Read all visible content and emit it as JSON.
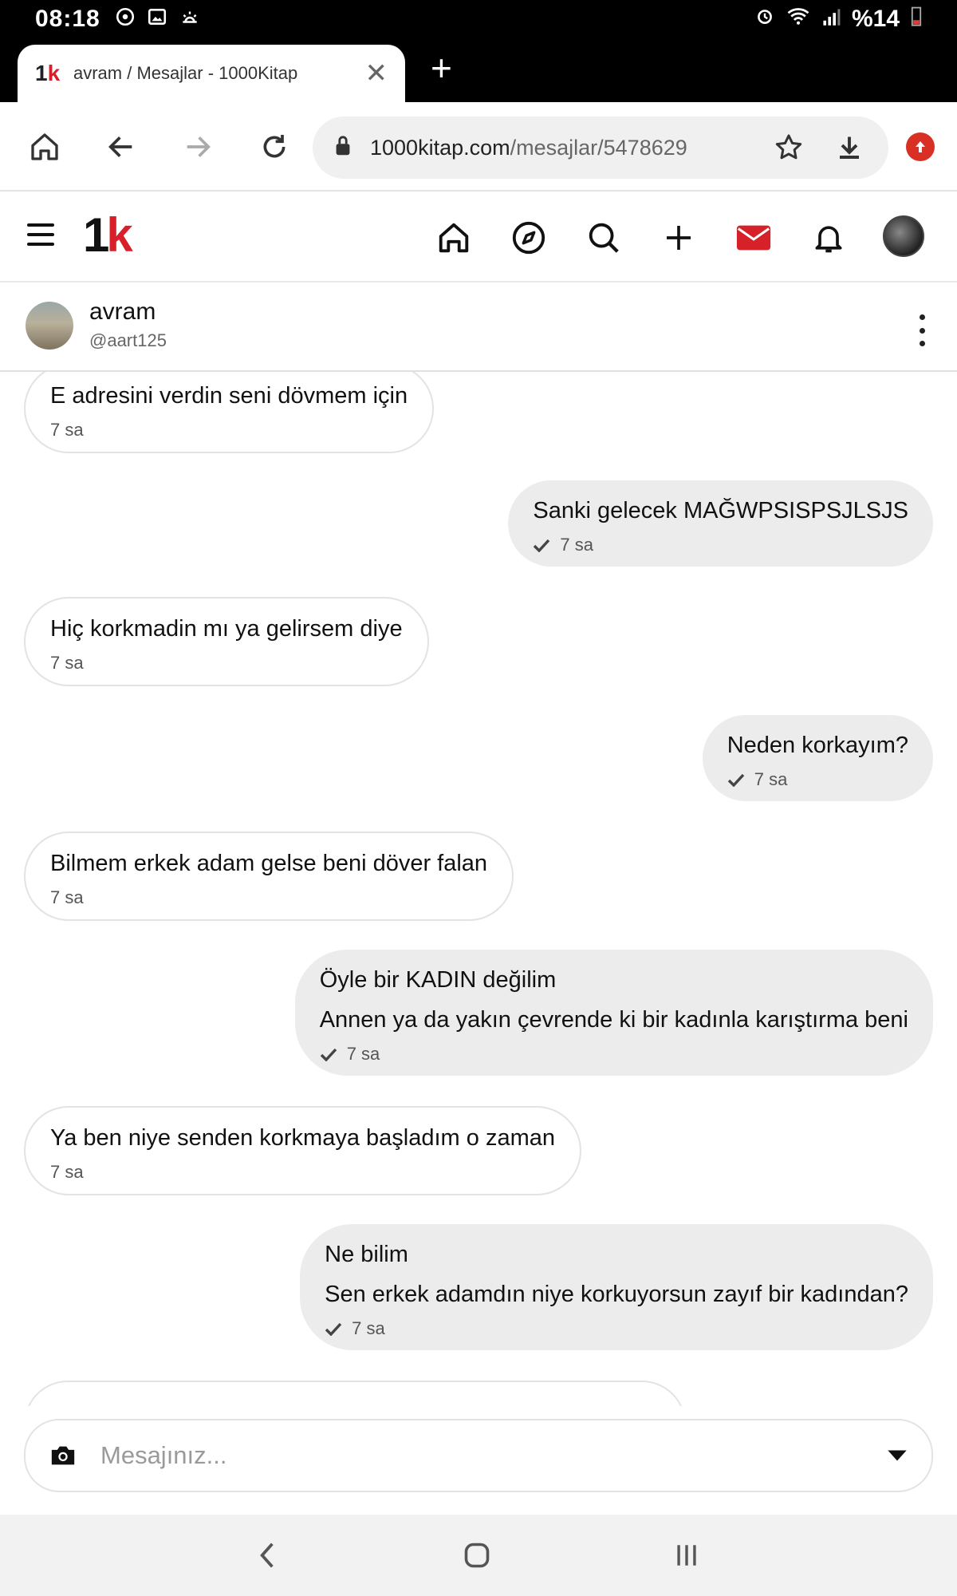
{
  "status_bar": {
    "time": "08:18",
    "battery": "%14",
    "left_icons": [
      "sync-icon",
      "gallery-icon",
      "weather-icon"
    ],
    "right_icons": [
      "alarm-icon",
      "wifi-icon",
      "signal-icon",
      "battery-icon"
    ]
  },
  "browser": {
    "tab_title": "avram / Mesajlar - 1000Kitap",
    "tab_logo_one": "1",
    "tab_logo_k": "k",
    "url_host": "1000kitap.com",
    "url_path": "/mesajlar/5478629",
    "accent_color": "#d93025"
  },
  "site": {
    "logo_one": "1",
    "logo_k": "k",
    "brand_color": "#d6202a",
    "nav_icons": [
      "home-icon",
      "explore-icon",
      "search-icon",
      "add-icon",
      "mail-icon",
      "bell-icon"
    ]
  },
  "chat": {
    "name": "avram",
    "handle": "@aart125"
  },
  "messages": [
    {
      "direction": "in",
      "lines": [
        "E adresini verdin seni dövmem için"
      ],
      "time": "7 sa"
    },
    {
      "direction": "out",
      "lines": [
        "Sanki gelecek MAĞWPSISPSJLSJS"
      ],
      "time": "7 sa"
    },
    {
      "direction": "in",
      "lines": [
        "Hiç korkmadin mı ya gelirsem diye"
      ],
      "time": "7 sa"
    },
    {
      "direction": "out",
      "lines": [
        "Neden korkayım?"
      ],
      "time": "7 sa"
    },
    {
      "direction": "in",
      "lines": [
        "Bilmem erkek adam gelse beni döver falan"
      ],
      "time": "7 sa"
    },
    {
      "direction": "out",
      "lines": [
        "Öyle bir KADIN değilim",
        "Annen ya da yakın çevrende ki bir kadınla karıştırma beni"
      ],
      "time": "7 sa"
    },
    {
      "direction": "in",
      "lines": [
        "Ya ben niye senden korkmaya başladım o zaman"
      ],
      "time": "7 sa"
    },
    {
      "direction": "out",
      "lines": [
        "Ne bilim",
        "Sen erkek adamdın niye korkuyorsun zayıf bir kadından?"
      ],
      "time": "7 sa"
    }
  ],
  "composer": {
    "placeholder": "Mesajınız..."
  }
}
